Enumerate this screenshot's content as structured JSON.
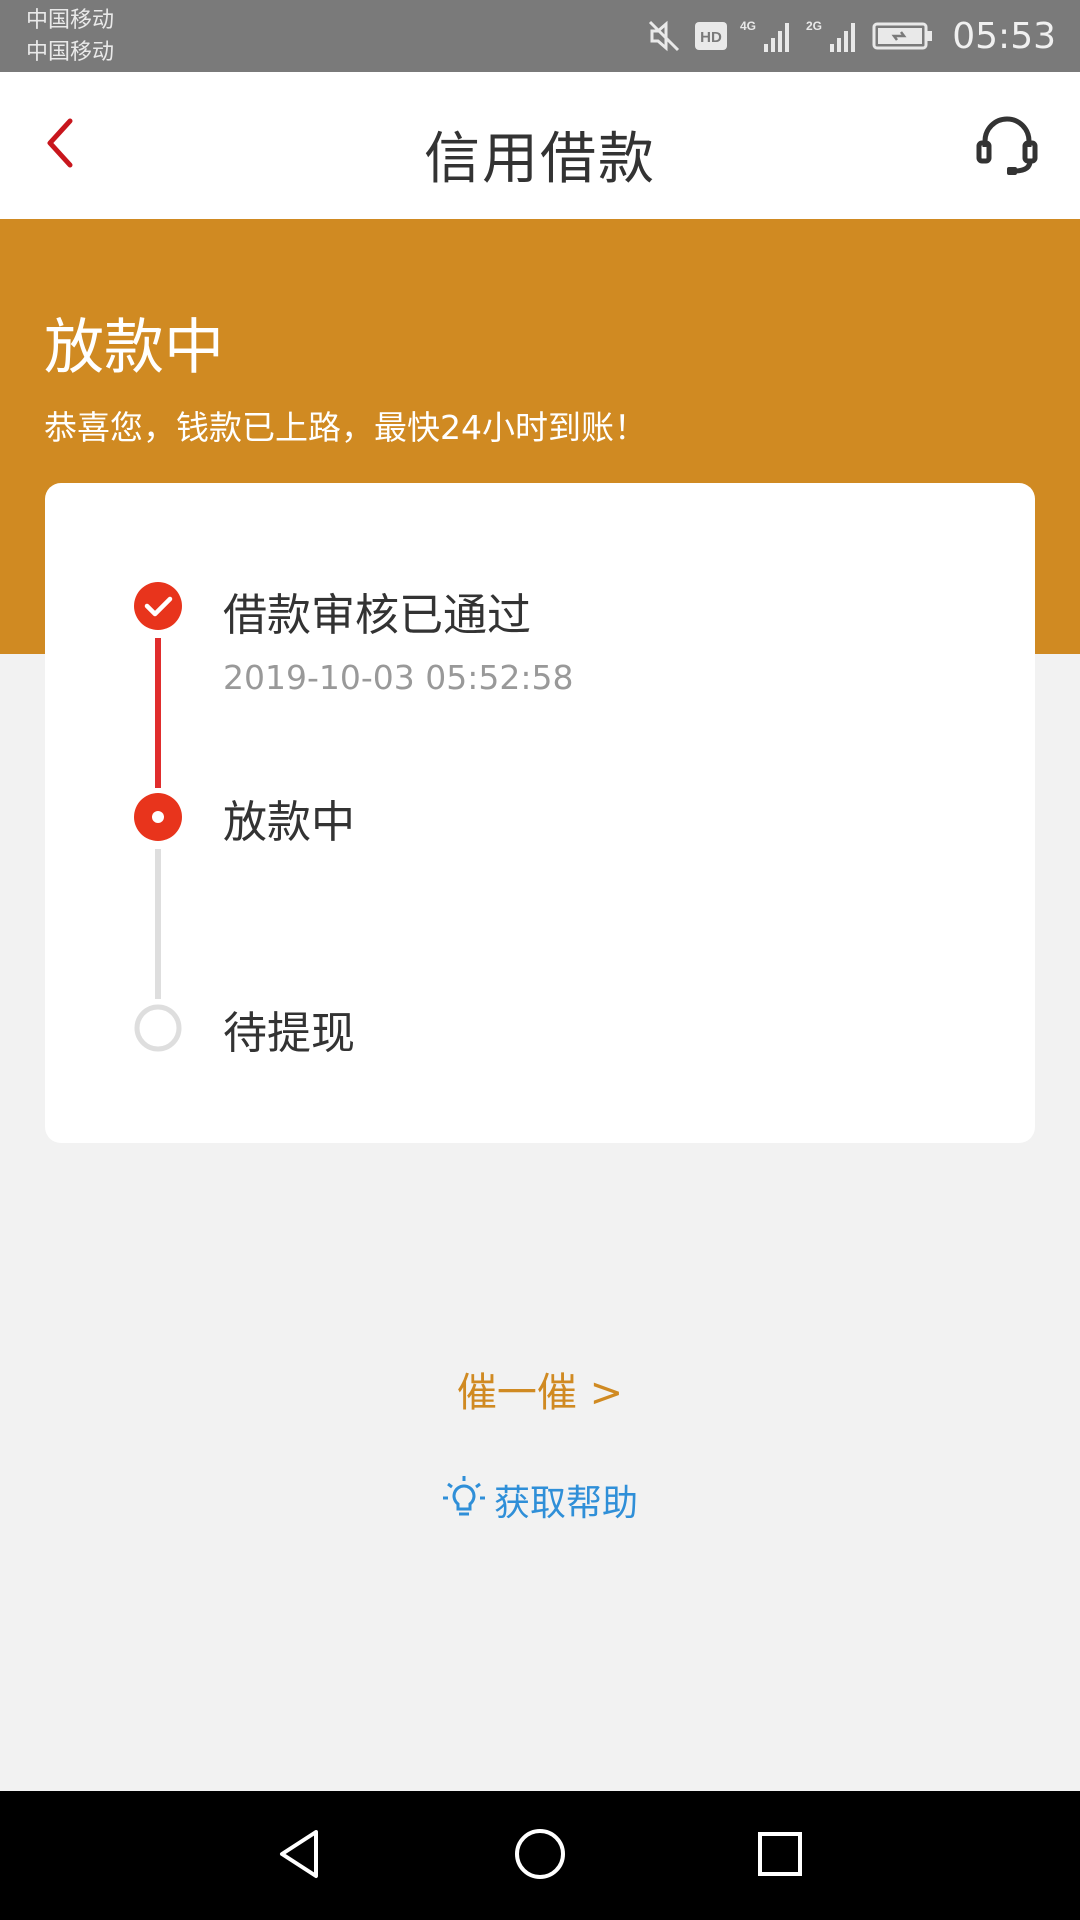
{
  "status_bar": {
    "carrier_1": "中国移动",
    "carrier_2": "中国移动",
    "hd_label": "HD",
    "net_1": "4G",
    "net_2": "2G",
    "time": "05:53"
  },
  "header": {
    "title": "信用借款",
    "back_icon": "chevron-left-icon",
    "support_icon": "headset-icon"
  },
  "banner": {
    "status": "放款中",
    "message": "恭喜您，钱款已上路，最快24小时到账！"
  },
  "steps": [
    {
      "title": "借款审核已通过",
      "time": "2019-10-03 05:52:58",
      "state": "done"
    },
    {
      "title": "放款中",
      "state": "current"
    },
    {
      "title": "待提现",
      "state": "pending"
    }
  ],
  "actions": {
    "urge_label": "催一催 >",
    "help_label": "获取帮助"
  },
  "colors": {
    "accent_orange": "#d08a22",
    "progress_red": "#e02d2d",
    "help_blue": "#2f8fd8"
  }
}
